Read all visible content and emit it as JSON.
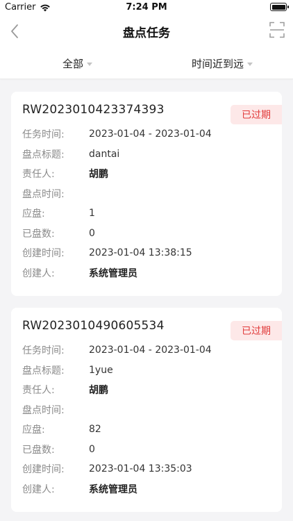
{
  "status_bar": {
    "carrier": "Carrier",
    "time": "7:24 PM"
  },
  "nav": {
    "title": "盘点任务"
  },
  "filters": {
    "status": "全部",
    "sort": "时间近到远"
  },
  "labels": {
    "task_time": "任务时间:",
    "title": "盘点标题:",
    "owner": "责任人:",
    "check_time": "盘点时间:",
    "should_count": "应盘:",
    "counted": "已盘数:",
    "created_at": "创建时间:",
    "creator": "创建人:"
  },
  "tasks": [
    {
      "code": "RW2023010423374393",
      "status": "已过期",
      "task_time": "2023-01-04 - 2023-01-04",
      "title": "dantai",
      "owner": "胡鹏",
      "check_time": "",
      "should_count": "1",
      "counted": "0",
      "created_at": "2023-01-04 13:38:15",
      "creator": "系统管理员"
    },
    {
      "code": "RW2023010490605534",
      "status": "已过期",
      "task_time": "2023-01-04 - 2023-01-04",
      "title": "1yue",
      "owner": "胡鹏",
      "check_time": "",
      "should_count": "82",
      "counted": "0",
      "created_at": "2023-01-04 13:35:03",
      "creator": "系统管理员"
    }
  ],
  "colors": {
    "badge_text": "#e13a3a",
    "badge_bg": "#fde8e8",
    "page_bg": "#f4f4f6"
  }
}
